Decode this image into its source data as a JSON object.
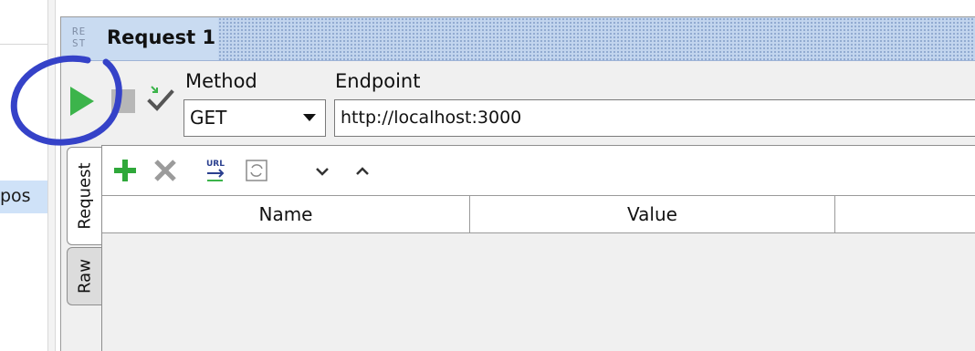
{
  "sidebar": {
    "selected_item_text": "pos"
  },
  "request_window": {
    "icon_text_line1": "RE",
    "icon_text_line2": "ST",
    "title": "Request 1"
  },
  "toolbar": {
    "method_label": "Method",
    "method_value": "GET",
    "endpoint_label": "Endpoint",
    "endpoint_value": "http://localhost:3000"
  },
  "tabs": [
    {
      "label": "Request",
      "selected": true
    },
    {
      "label": "Raw",
      "selected": false
    }
  ],
  "params_toolbar": {
    "url_icon_text": "URL"
  },
  "table": {
    "columns": [
      "Name",
      "Value"
    ]
  },
  "colors": {
    "run_green": "#3cb44b",
    "add_green": "#2fa83a",
    "annotation_blue": "#3542c8"
  }
}
